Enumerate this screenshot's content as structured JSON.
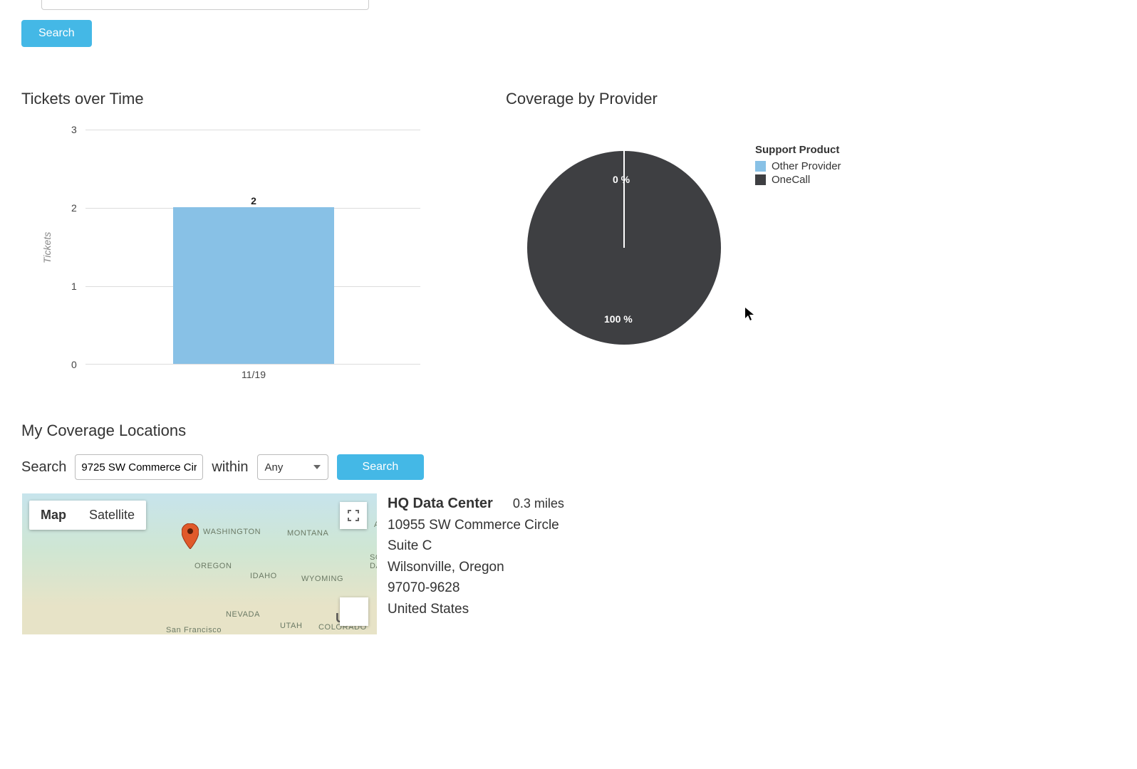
{
  "top_search": {
    "button": "Search"
  },
  "charts_row": {
    "left_title": "Tickets over Time",
    "right_title": "Coverage by Provider"
  },
  "bar_chart": {
    "y_label": "Tickets",
    "y_ticks": [
      "0",
      "1",
      "2",
      "3"
    ],
    "x_tick": "11/19",
    "bar_label": "2"
  },
  "pie_chart": {
    "legend_title": "Support Product",
    "legend_items": [
      "Other Provider",
      "OneCall"
    ],
    "label_zero": "0 %",
    "label_full": "100 %",
    "colors": {
      "other": "#88c1e6",
      "onecall": "#3e3f42"
    }
  },
  "coverage": {
    "title": "My Coverage Locations",
    "search_label": "Search",
    "search_value": "9725 SW Commerce Cir",
    "within_label": "within",
    "distance_value": "Any",
    "search_button": "Search"
  },
  "map": {
    "type_map": "Map",
    "type_sat": "Satellite",
    "regions": {
      "washington": "WASHINGTON",
      "montana": "MONTANA",
      "oregon": "OREGON",
      "idaho": "IDAHO",
      "wyoming": "WYOMING",
      "nevada": "NEVADA",
      "utah": "UTAH",
      "colorado": "COLORADO",
      "sf": "San Francisco",
      "so": "SO",
      "da": "DA",
      "a": "A"
    },
    "us_label": "Un"
  },
  "location": {
    "name": "HQ Data Center",
    "distance": "0.3 miles",
    "addr1": "10955 SW Commerce Circle",
    "addr2": "Suite C",
    "addr3": "Wilsonville, Oregon",
    "addr4": "97070-9628",
    "addr5": "United States"
  },
  "chart_data": [
    {
      "type": "bar",
      "title": "Tickets over Time",
      "ylabel": "Tickets",
      "ylim": [
        0,
        3
      ],
      "categories": [
        "11/19"
      ],
      "values": [
        2
      ]
    },
    {
      "type": "pie",
      "title": "Coverage by Provider",
      "legend_title": "Support Product",
      "series": [
        {
          "name": "Other Provider",
          "value": 0,
          "color": "#88c1e6"
        },
        {
          "name": "OneCall",
          "value": 100,
          "color": "#3e3f42"
        }
      ]
    }
  ]
}
